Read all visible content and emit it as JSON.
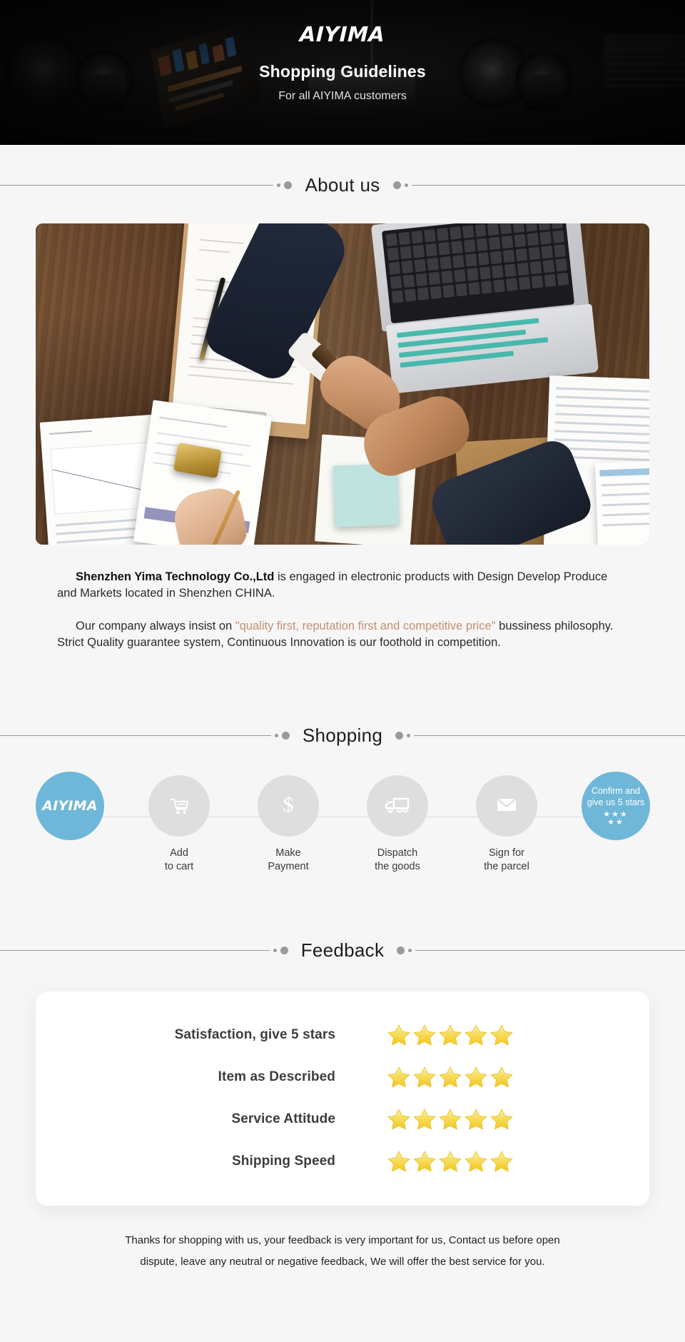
{
  "hero": {
    "logo": "AIYIMA",
    "title": "Shopping Guidelines",
    "subtitle": "For all AIYIMA customers"
  },
  "sections": {
    "about_title": "About us",
    "shopping_title": "Shopping",
    "feedback_title": "Feedback"
  },
  "about": {
    "para1_strong": "Shenzhen Yima Technology Co.,Ltd",
    "para1_rest": " is engaged in electronic products with Design Develop Produce and Markets located in Shenzhen CHINA.",
    "para2_before": "Our company always insist on ",
    "para2_quote": "\"quality first, reputation first and competitive price\"",
    "para2_after": " bussiness philosophy. Strict Quality guarantee system, Continuous Innovation is our foothold in competition."
  },
  "shopping": {
    "steps": [
      {
        "label": "",
        "label2": "",
        "icon": "aiyima-logo",
        "brand": "AIYIMA",
        "accent": true
      },
      {
        "label": "Add",
        "label2": "to cart",
        "icon": "shopping-cart-icon",
        "accent": false
      },
      {
        "label": "Make",
        "label2": "Payment",
        "icon": "dollar-icon",
        "accent": false
      },
      {
        "label": "Dispatch",
        "label2": "the goods",
        "icon": "truck-icon",
        "accent": false
      },
      {
        "label": "Sign for",
        "label2": "the parcel",
        "icon": "envelope-icon",
        "accent": false
      },
      {
        "label": "",
        "label2": "",
        "icon": "five-stars-icon",
        "accent": true,
        "final_line1": "Confirm and",
        "final_line2": "give us 5 stars",
        "stars_top": "★★★",
        "stars_bottom": "★★"
      }
    ]
  },
  "feedback": {
    "rows": [
      {
        "label": "Satisfaction, give 5 stars",
        "stars": 5
      },
      {
        "label": "Item as Described",
        "stars": 5
      },
      {
        "label": "Service Attitude",
        "stars": 5
      },
      {
        "label": "Shipping Speed",
        "stars": 5
      }
    ]
  },
  "footer": {
    "line1": "Thanks for shopping with us, your feedback is very important for us, Contact us before open",
    "line2": "dispute, leave any neutral or negative feedback, We will offer the best service for you."
  },
  "colors": {
    "accent_blue": "#6fb7d8",
    "quote_brown": "#c49070",
    "star_yellow": "#f5d33c",
    "page_bg": "#f6f6f6",
    "hero_bg": "#141414"
  }
}
